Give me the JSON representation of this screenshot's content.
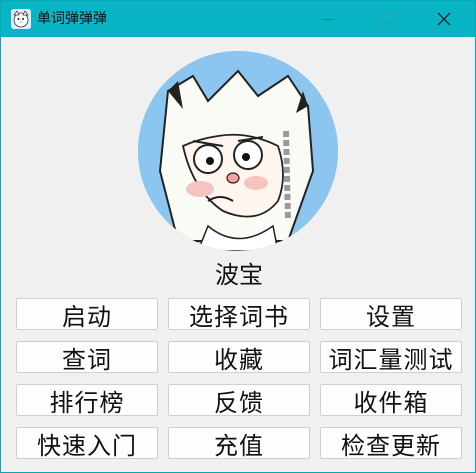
{
  "window": {
    "title": "单词弹弹弹"
  },
  "profile": {
    "name": "波宝"
  },
  "menu": {
    "buttons": [
      {
        "label": "启动"
      },
      {
        "label": "选择词书"
      },
      {
        "label": "设置"
      },
      {
        "label": "查词"
      },
      {
        "label": "收藏"
      },
      {
        "label": "词汇量测试"
      },
      {
        "label": "排行榜"
      },
      {
        "label": "反馈"
      },
      {
        "label": "收件箱"
      },
      {
        "label": "快速入门"
      },
      {
        "label": "充值"
      },
      {
        "label": "检查更新"
      }
    ]
  },
  "colors": {
    "titlebar": "#09b5c5",
    "background": "#f0f0f0",
    "avatar_bg": "#8cc6f0"
  }
}
